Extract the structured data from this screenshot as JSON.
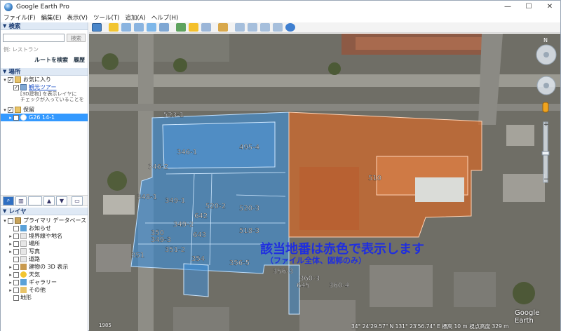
{
  "window": {
    "title": "Google Earth Pro",
    "min": "—",
    "max": "☐",
    "close": "✕"
  },
  "menu": [
    "ファイル(F)",
    "編集(E)",
    "表示(V)",
    "ツール(T)",
    "追加(A)",
    "ヘルプ(H)"
  ],
  "search": {
    "header": "検索",
    "placeholder": "",
    "button": "検索",
    "hint": "例: レストラン",
    "route": "ルートを検索",
    "history": "履歴"
  },
  "places": {
    "header": "場所",
    "favorites": "お気に入り",
    "tour": "観光ツアー",
    "tour_desc1": "[3D建物] を表示レイヤに",
    "tour_desc2": "チェックが入っていることを",
    "saved": "保留",
    "selected_item": "G26 14-1"
  },
  "layers": {
    "header": "レイヤ",
    "primary": "プライマリ データベース",
    "items": [
      "お知らせ",
      "境界線や地名",
      "場所",
      "写真",
      "道路",
      "建物の 3D 表示",
      "天気",
      "ギャラリー",
      "その他",
      "地形"
    ]
  },
  "parcels": {
    "blue": [
      "523-1",
      "346-1",
      "495-4",
      "346-2",
      "348-1",
      "349-1",
      "520-2",
      "520-3",
      "642",
      "349-2",
      "518-3",
      "350",
      "643",
      "349-3",
      "351-2",
      "351",
      "354",
      "356-5"
    ],
    "orange": [
      "510"
    ],
    "lower": [
      "356-3",
      "360-3",
      "645",
      "360-4"
    ]
  },
  "annotation": {
    "main": "該当地番は赤色で表示します",
    "sub": "（ファイル全体、図郭のみ）"
  },
  "status": {
    "year": "1985",
    "coords": "34° 24'29.57\" N  131° 23'56.74\" E  標高  10 m  視点高度  329 m"
  },
  "watermark": "Google Earth",
  "colors": {
    "blue_parcel": "#3f8fd8",
    "orange_parcel": "#d2692a",
    "annotation": "#1f2ee0",
    "selection": "#3399ff"
  }
}
